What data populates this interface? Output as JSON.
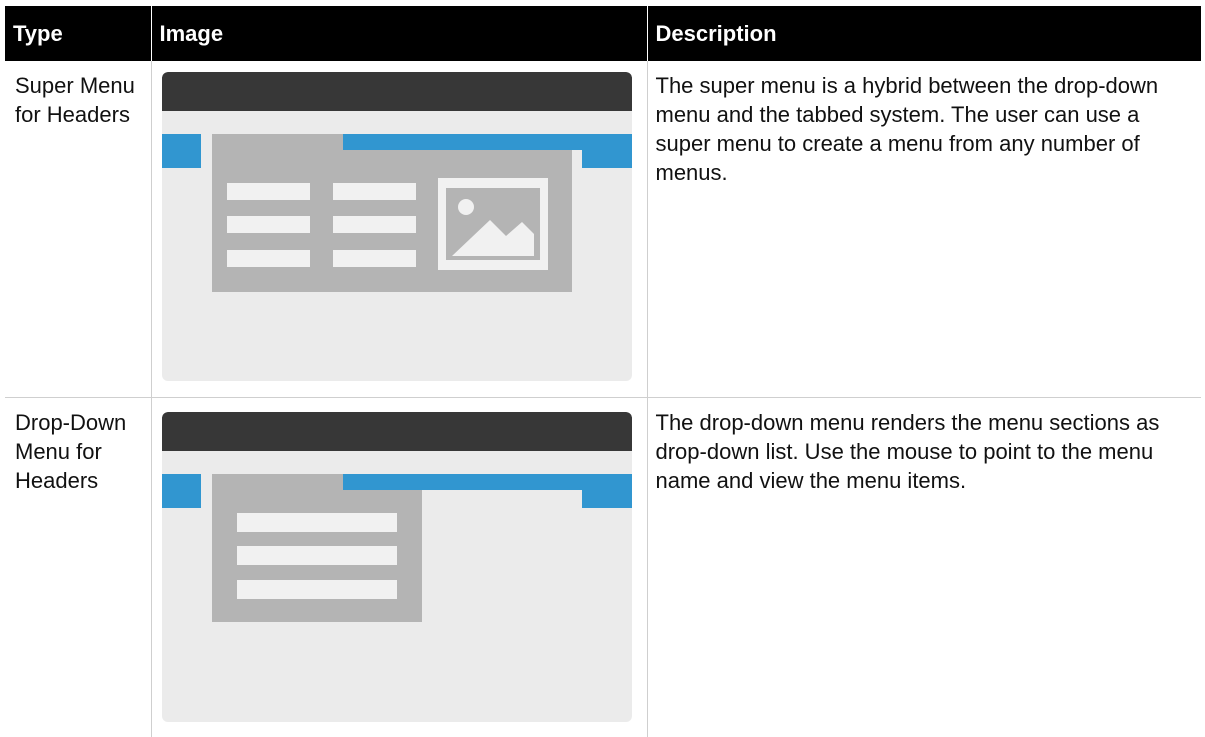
{
  "table": {
    "headers": {
      "type": "Type",
      "image": "Image",
      "description": "Description"
    },
    "rows": [
      {
        "type_label": "Super Menu for Headers",
        "illustration": "super-menu-illustration",
        "description": "The super menu is a hybrid between the drop-down menu and the tabbed system. The user can use a super menu to create a menu from any number of menus."
      },
      {
        "type_label": "Drop-Down Menu for Headers",
        "illustration": "drop-down-menu-illustration",
        "description": "The drop-down menu renders the menu sections as drop-down list. Use the mouse to point to the menu name and view the menu items."
      }
    ]
  },
  "colors": {
    "header_bg": "#000000",
    "header_text": "#ffffff",
    "accent_blue": "#3196d0",
    "illustration_bg": "#ebebeb",
    "illustration_topbar": "#373737",
    "panel_gray": "#b4b4b4"
  }
}
